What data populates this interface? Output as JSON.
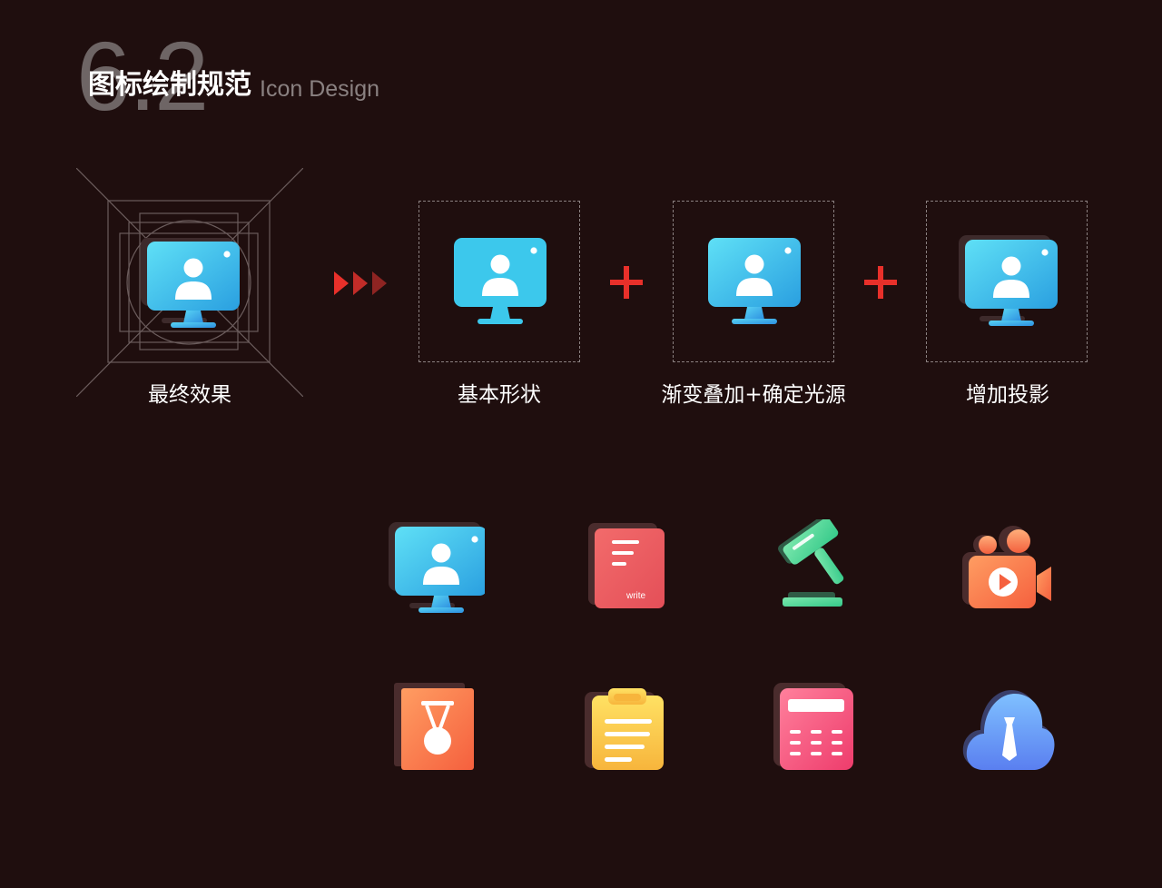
{
  "header": {
    "number": "6.2",
    "title": "图标绘制规范",
    "subtitle": "Icon Design"
  },
  "steps": [
    {
      "label": "最终效果"
    },
    {
      "label": "基本形状"
    },
    {
      "label": "渐变叠加+确定光源"
    },
    {
      "label": "增加投影"
    }
  ],
  "icons": {
    "write_label": "write"
  },
  "colors": {
    "background": "#1f0e0e",
    "accent_red": "#e8302a",
    "grid_line": "#6b5c5c",
    "monitor_blue": "#3cc8ec",
    "pink_red": "#ec5b5b",
    "green": "#4ed69a",
    "orange": "#ff8a50",
    "yellow": "#ffcd4f",
    "pink": "#ff5a84",
    "cloud_blue": "#5d92f2"
  }
}
